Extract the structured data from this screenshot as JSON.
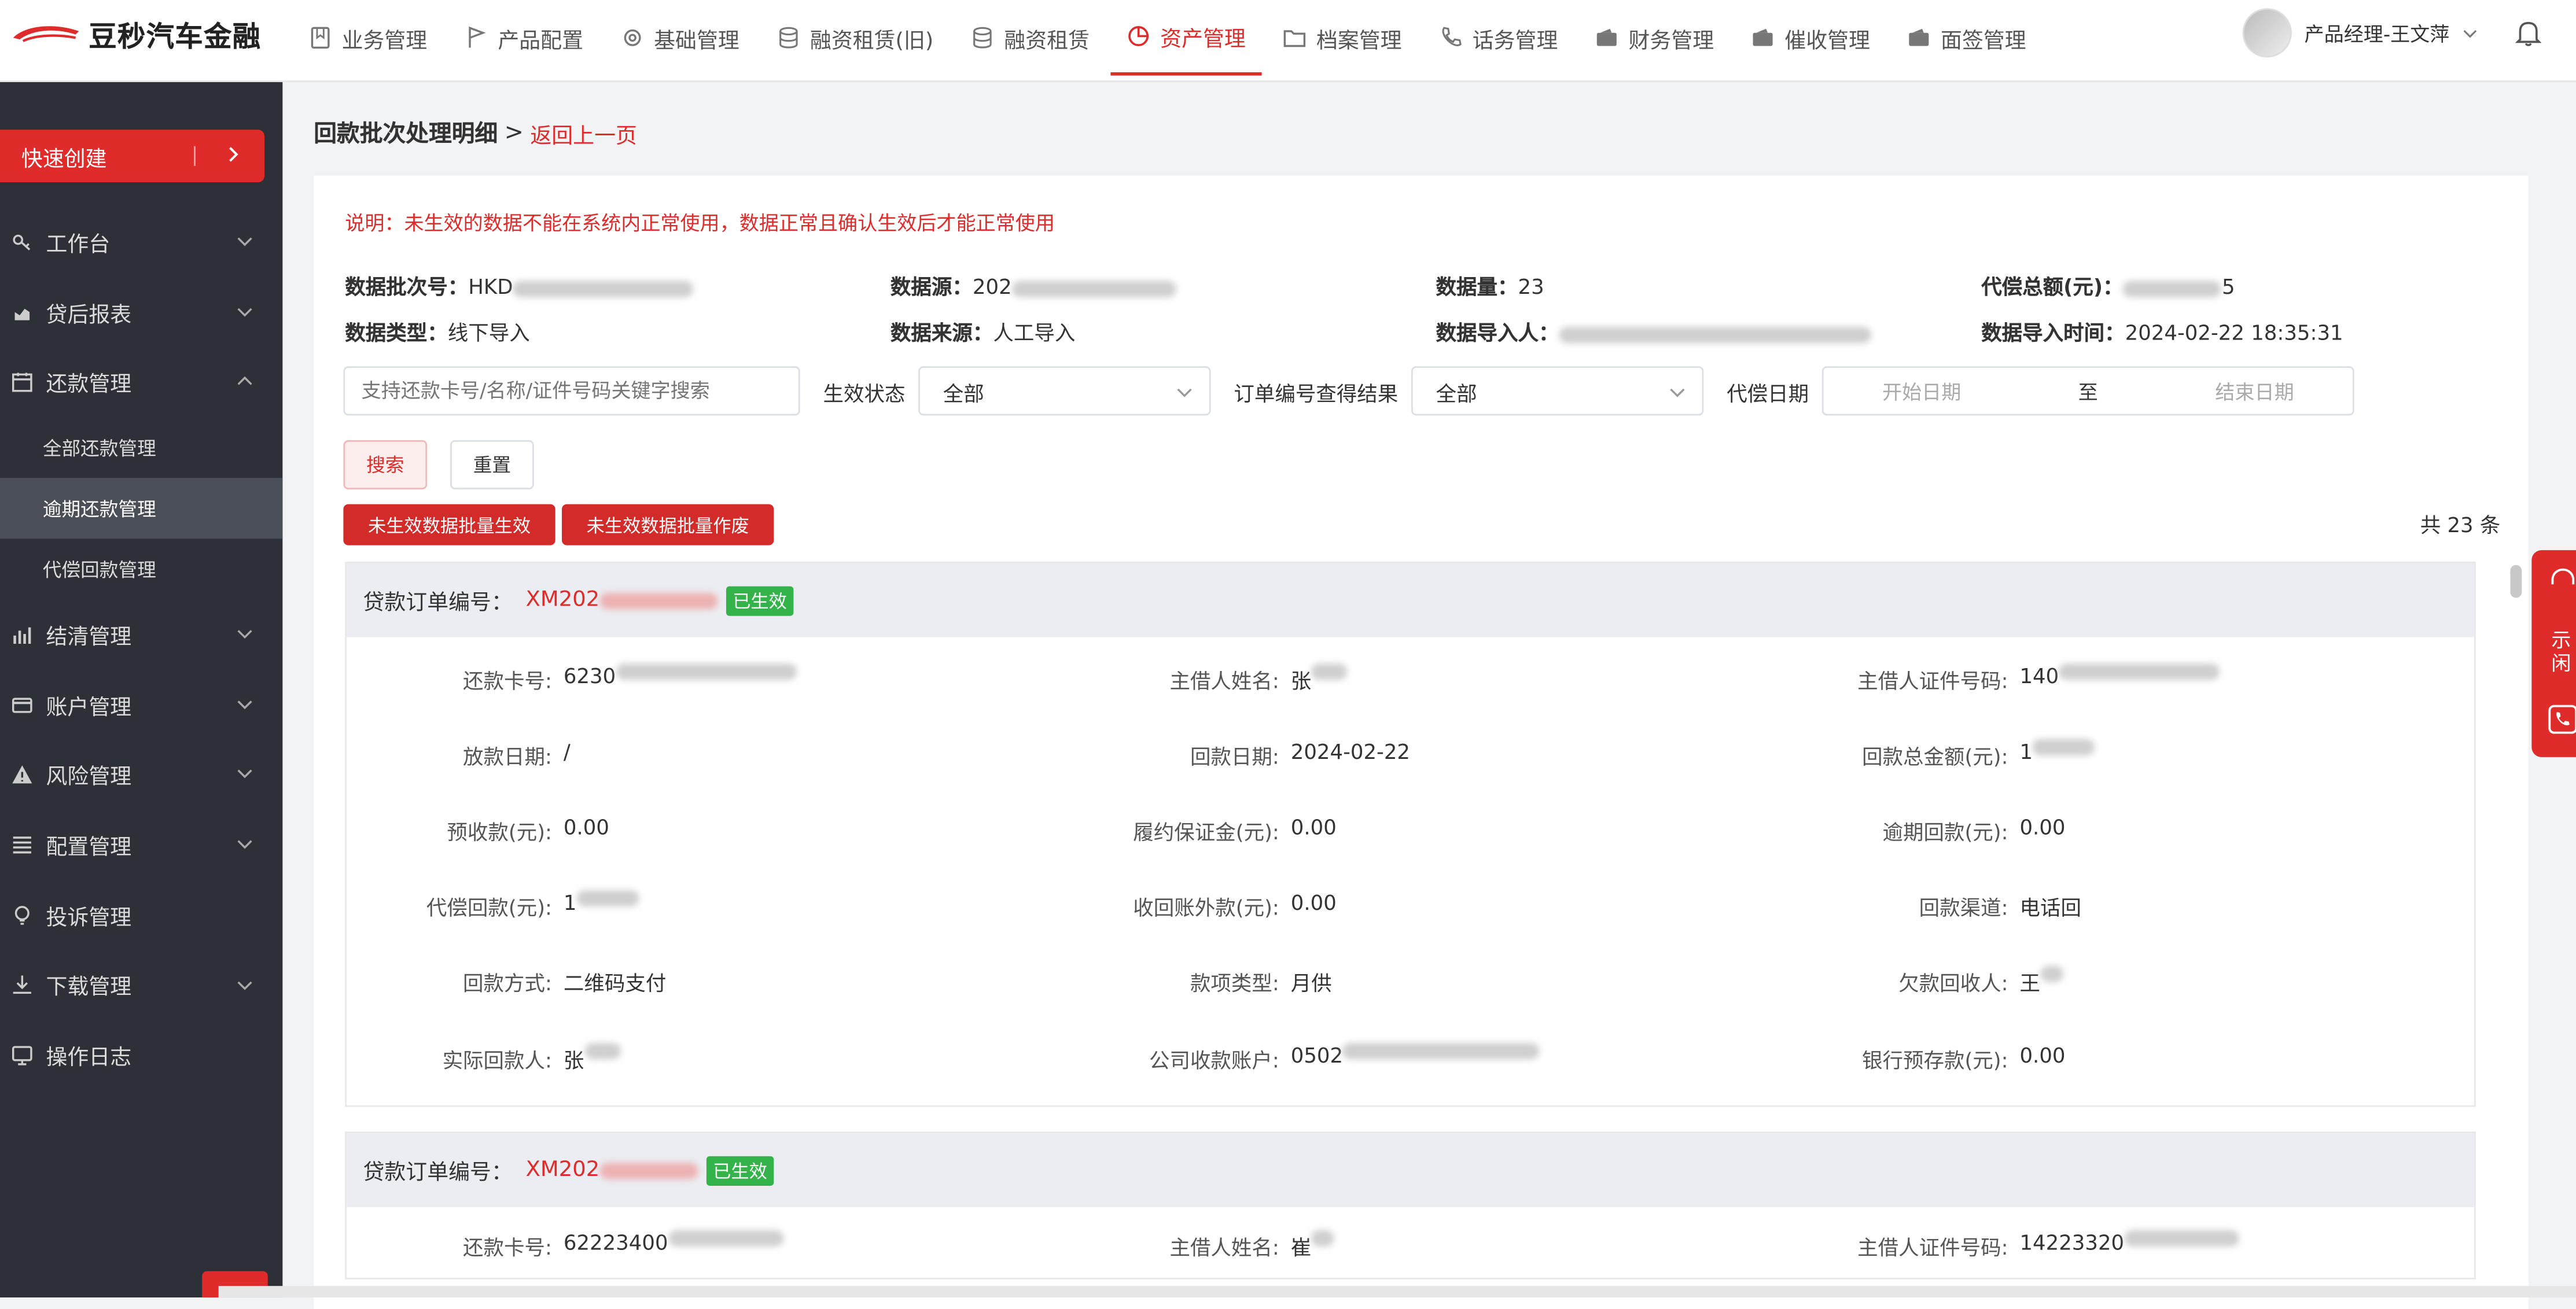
{
  "app": {
    "logo_text": "豆秒汽车金融",
    "brand_color": "#e02b2b"
  },
  "nav": {
    "items": [
      {
        "label": "业务管理",
        "icon": "bookmark-icon"
      },
      {
        "label": "产品配置",
        "icon": "flag-icon"
      },
      {
        "label": "基础管理",
        "icon": "gear-icon"
      },
      {
        "label": "融资租赁(旧)",
        "icon": "database-icon"
      },
      {
        "label": "融资租赁",
        "icon": "database-icon"
      },
      {
        "label": "资产管理",
        "icon": "pie-icon",
        "active": true
      },
      {
        "label": "档案管理",
        "icon": "folder-icon"
      },
      {
        "label": "话务管理",
        "icon": "phone-icon"
      },
      {
        "label": "财务管理",
        "icon": "wallet-icon"
      },
      {
        "label": "催收管理",
        "icon": "wallet-icon"
      },
      {
        "label": "面签管理",
        "icon": "wallet-icon"
      }
    ],
    "user_name": "产品经理-王文萍"
  },
  "sidebar": {
    "quick_create": "快速创建",
    "menu": [
      {
        "label": "工作台",
        "icon": "key-icon"
      },
      {
        "label": "贷后报表",
        "icon": "chart-icon"
      },
      {
        "label": "还款管理",
        "icon": "calendar-icon",
        "expanded": true
      },
      {
        "label": "结清管理",
        "icon": "bar-chart-icon"
      },
      {
        "label": "账户管理",
        "icon": "card-icon"
      },
      {
        "label": "风险管理",
        "icon": "warning-icon"
      },
      {
        "label": "配置管理",
        "icon": "list-icon"
      },
      {
        "label": "投诉管理",
        "icon": "bulb-icon"
      },
      {
        "label": "下载管理",
        "icon": "download-icon"
      },
      {
        "label": "操作日志",
        "icon": "monitor-icon"
      }
    ],
    "submenu": [
      "全部还款管理",
      "逾期还款管理",
      "代偿回款管理"
    ],
    "active_sub": "逾期还款管理"
  },
  "page": {
    "title": "回款批次处理明细",
    "sep": ">",
    "back": "返回上一页",
    "notice": "说明：未生效的数据不能在系统内正常使用，数据正常且确认生效后才能正常使用"
  },
  "info": {
    "row1": [
      {
        "k": "数据批次号：",
        "v": "HKD"
      },
      {
        "k": "数据源：",
        "v": "202"
      },
      {
        "k": "数据量：",
        "v": "23"
      },
      {
        "k": "代偿总额(元)：",
        "v": "5"
      }
    ],
    "row2": [
      {
        "k": "数据类型：",
        "v": "线下导入"
      },
      {
        "k": "数据来源：",
        "v": "人工导入"
      },
      {
        "k": "数据导入人：",
        "v": ""
      },
      {
        "k": "数据导入时间：",
        "v": "2024-02-22 18:35:31"
      }
    ]
  },
  "filters": {
    "search_placeholder": "支持还款卡号/名称/证件号码关键字搜索",
    "status_label": "生效状态",
    "status_value": "全部",
    "order_label": "订单编号查得结果",
    "order_value": "全部",
    "date_label": "代偿日期",
    "start_placeholder": "开始日期",
    "to": "至",
    "end_placeholder": "结束日期"
  },
  "buttons": {
    "search": "搜索",
    "reset": "重置",
    "batch_effect": "未生效数据批量生效",
    "batch_void": "未生效数据批量作废"
  },
  "total": "共 23 条",
  "cards": [
    {
      "order_label": "贷款订单编号：",
      "order_no": "XM202",
      "status": "已生效",
      "rows": [
        [
          {
            "k": "还款卡号:",
            "v": "6230"
          },
          {
            "k": "主借人姓名:",
            "v": "张"
          },
          {
            "k": "主借人证件号码:",
            "v": "140"
          }
        ],
        [
          {
            "k": "放款日期:",
            "v": "/"
          },
          {
            "k": "回款日期:",
            "v": "2024-02-22"
          },
          {
            "k": "回款总金额(元):",
            "v": "1"
          }
        ],
        [
          {
            "k": "预收款(元):",
            "v": "0.00"
          },
          {
            "k": "履约保证金(元):",
            "v": "0.00"
          },
          {
            "k": "逾期回款(元):",
            "v": "0.00"
          }
        ],
        [
          {
            "k": "代偿回款(元):",
            "v": "1"
          },
          {
            "k": "收回账外款(元):",
            "v": "0.00"
          },
          {
            "k": "回款渠道:",
            "v": "电话回"
          }
        ],
        [
          {
            "k": "回款方式:",
            "v": "二维码支付"
          },
          {
            "k": "款项类型:",
            "v": "月供"
          },
          {
            "k": "欠款回收人:",
            "v": "王"
          }
        ],
        [
          {
            "k": "实际回款人:",
            "v": "张"
          },
          {
            "k": "公司收款账户:",
            "v": "0502"
          },
          {
            "k": "银行预存款(元):",
            "v": "0.00"
          }
        ]
      ]
    },
    {
      "order_label": "贷款订单编号：",
      "order_no": "XM202",
      "status": "已生效",
      "rows": [
        [
          {
            "k": "还款卡号:",
            "v": "62223400"
          },
          {
            "k": "主借人姓名:",
            "v": "崔"
          },
          {
            "k": "主借人证件号码:",
            "v": "14223320"
          }
        ]
      ]
    }
  ],
  "right_float": {
    "label": "示闲"
  }
}
